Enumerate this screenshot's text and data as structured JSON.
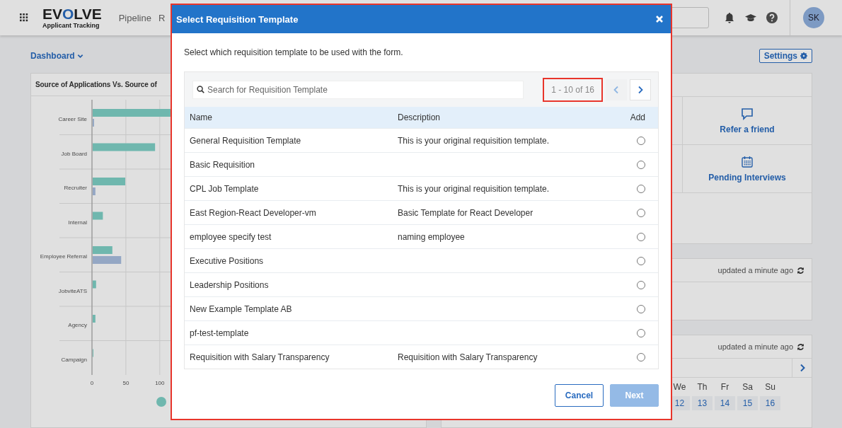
{
  "header": {
    "logo": [
      {
        "text": "EV",
        "accent": false
      },
      {
        "text": "O",
        "accent": true
      },
      {
        "text": "LVE",
        "accent": false
      }
    ],
    "logo_subtitle": "Applicant Tracking",
    "nav": [
      "Pipeline",
      "R"
    ],
    "avatar": "SK"
  },
  "dashboard": {
    "menu": "Dashboard",
    "settings": "Settings"
  },
  "chart_card": {
    "title": "Source of Applications Vs. Source of",
    "chart_data": {
      "type": "bar",
      "orientation": "horizontal",
      "categories": [
        "Career Site",
        "Job Board",
        "Recruiter",
        "Internal",
        "Employee Referral",
        "JobviteATS",
        "Agency",
        "Campaign"
      ],
      "series": [
        {
          "color": "#7fd1c7",
          "values": [
            115,
            92,
            48,
            15,
            29,
            5,
            4,
            1
          ]
        },
        {
          "color": "#a9bfe0",
          "values": [
            2,
            0,
            4,
            0,
            42,
            0,
            0,
            0
          ]
        }
      ],
      "xlim": [
        0,
        120
      ],
      "xticks": [
        0,
        50,
        100
      ]
    }
  },
  "quick_links": [
    {
      "kind": "chat",
      "label": "Refer a friend"
    },
    {
      "kind": "calendar",
      "label": "Pending Interviews"
    }
  ],
  "updates": [
    "updated a minute ago",
    "updated a minute ago"
  ],
  "week": {
    "days": [
      "We",
      "Th",
      "Fr",
      "Sa",
      "Su"
    ],
    "dates": [
      "12",
      "13",
      "14",
      "15",
      "16"
    ]
  },
  "modal": {
    "title": "Select Requisition Template",
    "highlighted": true,
    "intro": "Select which requisition template to be used with the form.",
    "search": {
      "placeholder": "Search for Requisition Template"
    },
    "pagination": {
      "text": "1 - 10 of 16",
      "highlighted": true,
      "prev_disabled": true,
      "next_disabled": false
    },
    "columns": [
      "Name",
      "Description",
      "Add"
    ],
    "rows": [
      {
        "name": "General Requisition Template",
        "description": "This is your original requisition template.",
        "selected": false
      },
      {
        "name": "Basic Requisition",
        "selected": false
      },
      {
        "name": "CPL Job Template",
        "description": "This is your original requisition template.",
        "selected": false
      },
      {
        "name": "East Region-React Developer-vm",
        "description": "Basic Template for React Developer",
        "selected": false
      },
      {
        "name": "employee specify test",
        "description": "naming employee",
        "selected": false
      },
      {
        "name": "Executive Positions",
        "selected": false
      },
      {
        "name": "Leadership Positions",
        "selected": false
      },
      {
        "name": "New Example Template AB",
        "selected": false
      },
      {
        "name": "pf-test-template",
        "selected": false
      },
      {
        "name": "Requisition with Salary Transparency",
        "description": "Requisition with Salary Transparency",
        "selected": false
      }
    ],
    "buttons": [
      {
        "label": "Cancel",
        "kind": "secondary",
        "disabled": false
      },
      {
        "label": "Next",
        "kind": "primary",
        "disabled": true
      }
    ]
  }
}
